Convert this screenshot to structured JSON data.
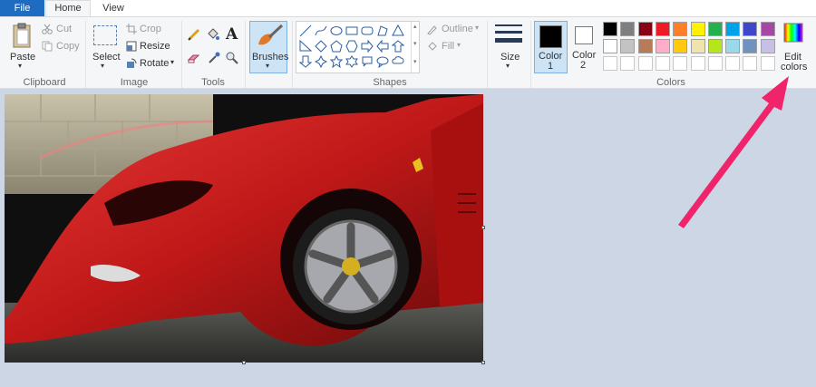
{
  "tabs": {
    "file": "File",
    "home": "Home",
    "view": "View"
  },
  "clipboard": {
    "paste": "Paste",
    "cut": "Cut",
    "copy": "Copy",
    "group": "Clipboard"
  },
  "image": {
    "select": "Select",
    "crop": "Crop",
    "resize": "Resize",
    "rotate": "Rotate",
    "group": "Image"
  },
  "tools": {
    "group": "Tools",
    "text_glyph": "A"
  },
  "brushes": {
    "label": "Brushes"
  },
  "shapes": {
    "outline": "Outline",
    "fill": "Fill",
    "group": "Shapes"
  },
  "size": {
    "label": "Size"
  },
  "colors": {
    "color1_label": "Color",
    "color1_num": "1",
    "color2_label": "Color",
    "color2_num": "2",
    "edit_line1": "Edit",
    "edit_line2": "colors",
    "group": "Colors",
    "color1_value": "#000000",
    "color2_value": "#ffffff",
    "palette_row1": [
      "#000000",
      "#7f7f7f",
      "#880015",
      "#ed1c24",
      "#ff7f27",
      "#fff200",
      "#22b14c",
      "#00a2e8",
      "#3f48cc",
      "#a349a4"
    ],
    "palette_row2": [
      "#ffffff",
      "#c3c3c3",
      "#b97a57",
      "#ffaec9",
      "#ffc90e",
      "#efe4b0",
      "#b5e61d",
      "#99d9ea",
      "#7092be",
      "#c8bfe7"
    ],
    "palette_row3": [
      "#ffffff",
      "#ffffff",
      "#ffffff",
      "#ffffff",
      "#ffffff",
      "#ffffff",
      "#ffffff",
      "#ffffff",
      "#ffffff",
      "#ffffff"
    ]
  },
  "annotation": {
    "arrow_color": "#f0246a"
  }
}
